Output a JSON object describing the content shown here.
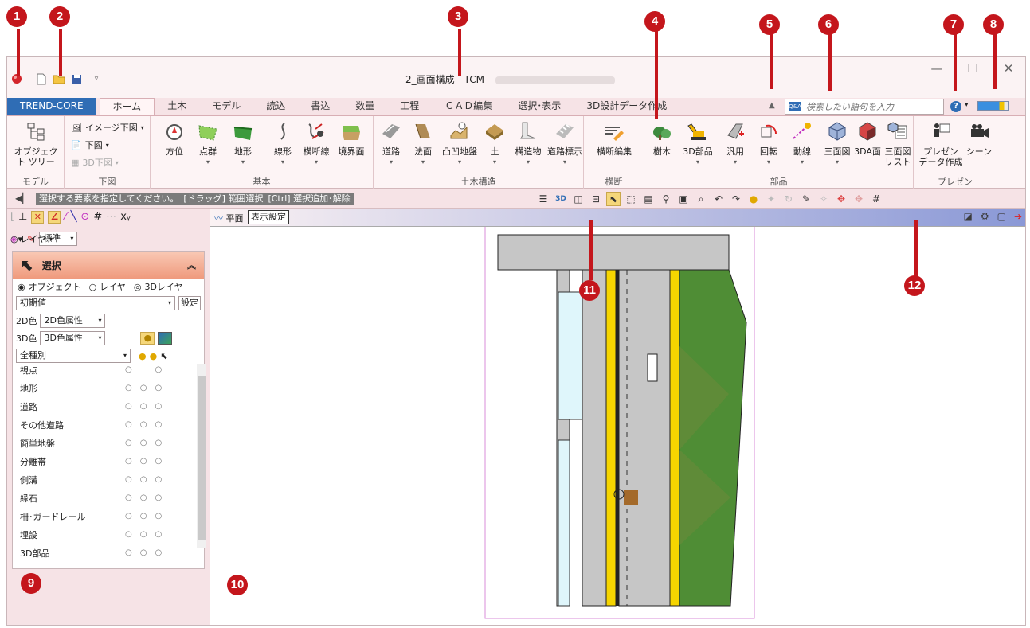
{
  "window": {
    "title": "2_画面構成 - TCM -",
    "minimize": "—",
    "maximize": "☐",
    "close": "✕"
  },
  "quick_access": [
    "app-icon",
    "new-file-icon",
    "open-folder-icon",
    "save-icon",
    "customize-icon"
  ],
  "tabs": [
    {
      "label": "TREND-CORE"
    },
    {
      "label": "ホーム"
    },
    {
      "label": "土木"
    },
    {
      "label": "モデル"
    },
    {
      "label": "読込"
    },
    {
      "label": "書込"
    },
    {
      "label": "数量"
    },
    {
      "label": "工程"
    },
    {
      "label": "ＣＡＤ編集"
    },
    {
      "label": "選択･表示"
    },
    {
      "label": "3D設計データ作成"
    }
  ],
  "search": {
    "placeholder": "検索したい語句を入力",
    "badge": "Q&A"
  },
  "ribbon": {
    "model": {
      "label": "モデル",
      "object_tree": "オブジェクト ツリー"
    },
    "underlay": {
      "label": "下図",
      "image": "イメージ下図",
      "underlay": "下図",
      "underlay_3d": "3D下図"
    },
    "basic": {
      "label": "基本",
      "direction": "方位",
      "points": "点群",
      "terrain": "地形",
      "alignment": "線形",
      "cross_line": "横断線",
      "boundary": "境界面"
    },
    "civil": {
      "label": "土木構造",
      "road": "道路",
      "slope": "法面",
      "ground": "凸凹地盤",
      "soil": "土",
      "structure": "構造物",
      "road_sign": "道路標示"
    },
    "cross": {
      "label": "横断",
      "edit": "横断編集"
    },
    "parts": {
      "label": "部品",
      "tree": "樹木",
      "parts3d": "3D部品",
      "general": "汎用",
      "rotate": "回転",
      "motion": "動線",
      "three_views": "三面図",
      "face_3da": "3DA面",
      "three_view_list": "三面図 リスト"
    },
    "presen": {
      "label": "プレゼン",
      "create": "プレゼン データ作成",
      "scene": "シーン"
    }
  },
  "command_bar": {
    "prompt": "選択する要素を指定してください。",
    "drag": "[ドラッグ] 範囲選択",
    "ctrl": "[Ctrl] 選択追加･解除"
  },
  "side_panel": {
    "linetype": "標準",
    "layer_btn": "レイヤ",
    "title": "選択",
    "radios": [
      "オブジェクト",
      "レイヤ",
      "3Dレイヤ"
    ],
    "preset": "初期値",
    "set_btn": "設定",
    "color2d_label": "2D色",
    "color2d_value": "2D色属性",
    "color3d_label": "3D色",
    "color3d_value": "3D色属性",
    "category": "全種別",
    "items": [
      "視点",
      "地形",
      "道路",
      "その他道路",
      "簡単地盤",
      "分離帯",
      "側溝",
      "縁石",
      "柵･ガードレール",
      "埋設",
      "3D部品"
    ]
  },
  "view": {
    "tab": "平面",
    "display_settings": "表示設定"
  },
  "callouts": [
    "1",
    "2",
    "3",
    "4",
    "5",
    "6",
    "7",
    "8",
    "9",
    "10",
    "11",
    "12"
  ],
  "colors": {
    "accent": "#c4161c",
    "brand": "#2f6db5",
    "ribbon_bg": "#fdf4f5",
    "grass": "#4a8a37",
    "road_yellow": "#f6d500"
  }
}
